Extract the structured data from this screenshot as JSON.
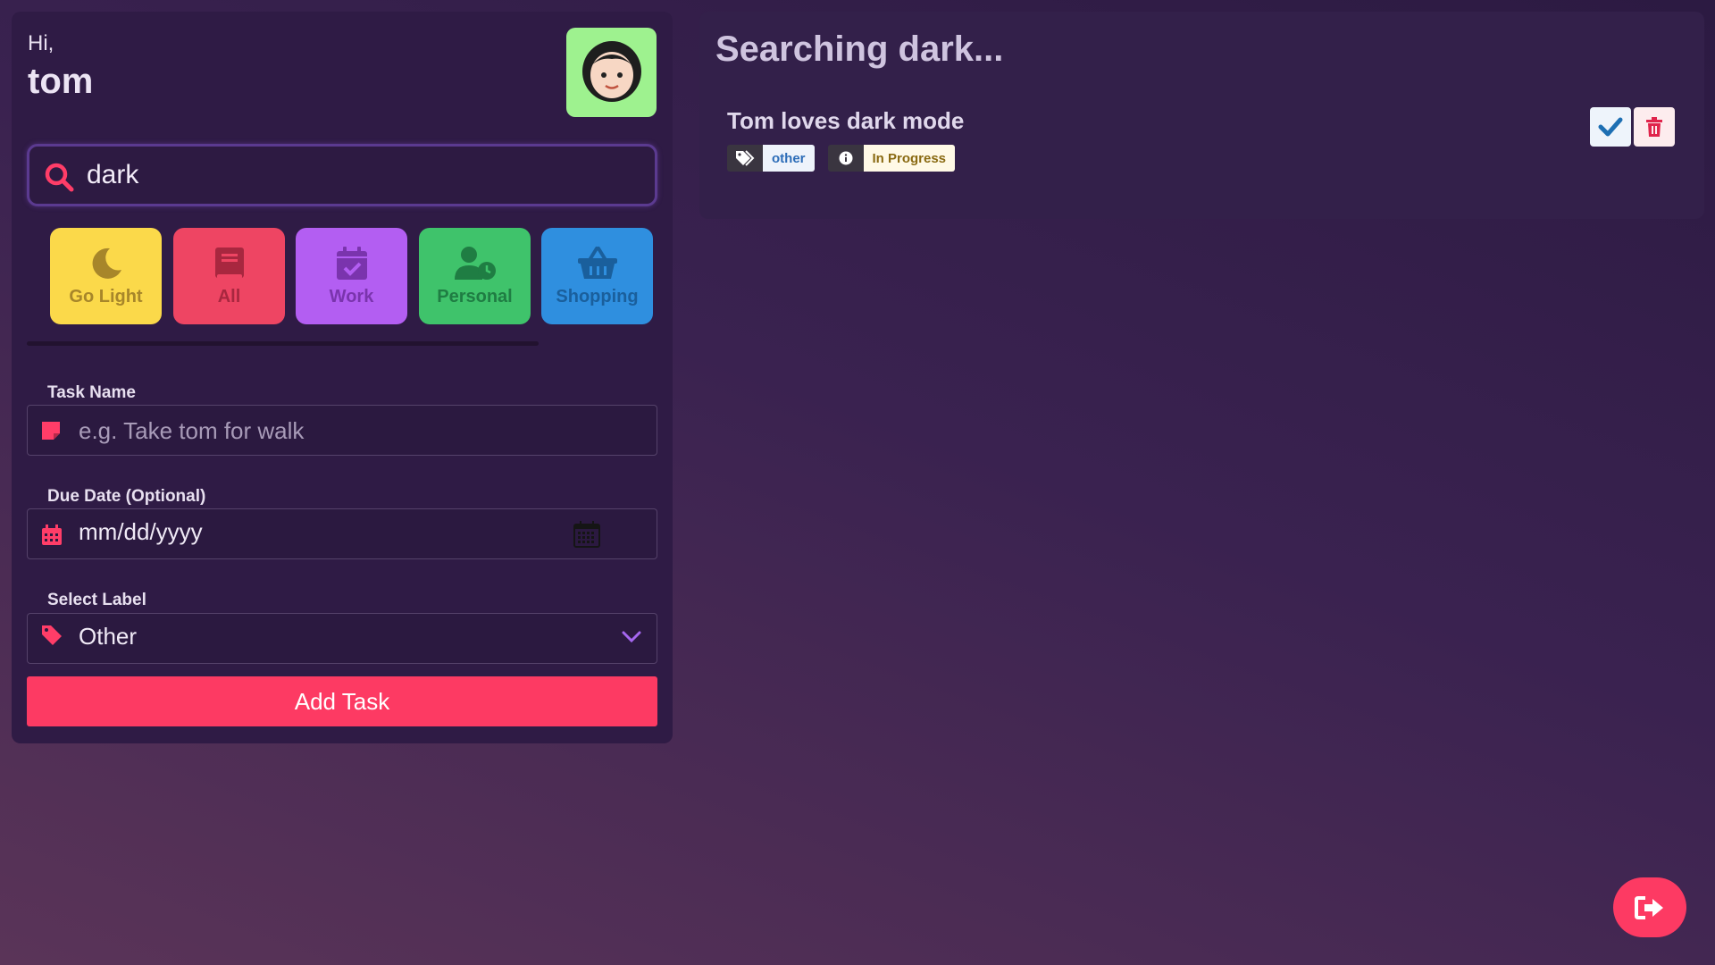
{
  "greeting": {
    "hi": "Hi,",
    "name": "tom",
    "avatar_icon": "woman-face-icon"
  },
  "search": {
    "value": "dark",
    "icon": "search-icon"
  },
  "categories": [
    {
      "label": "Go Light",
      "icon": "moon-icon",
      "color": "#fbd94a"
    },
    {
      "label": "All",
      "icon": "book-icon",
      "color": "#ee4563"
    },
    {
      "label": "Work",
      "icon": "calendar-check-icon",
      "color": "#b35ef2"
    },
    {
      "label": "Personal",
      "icon": "user-clock-icon",
      "color": "#3fc36b"
    },
    {
      "label": "Shopping",
      "icon": "basket-icon",
      "color": "#2f8fdf"
    }
  ],
  "form": {
    "task_name_label": "Task Name",
    "task_name_placeholder": "e.g. Take tom for walk",
    "due_date_label": "Due Date (Optional)",
    "due_date_placeholder": "mm/dd/yyyy",
    "select_label": "Select Label",
    "selected_label": "Other",
    "add_button": "Add Task"
  },
  "results": {
    "title": "Searching dark...",
    "tasks": [
      {
        "name": "Tom loves dark mode",
        "label": "other",
        "status": "In Progress"
      }
    ]
  },
  "colors": {
    "accent": "#fd3a63",
    "panel": "#2f1b45",
    "background": "#3a2250"
  }
}
